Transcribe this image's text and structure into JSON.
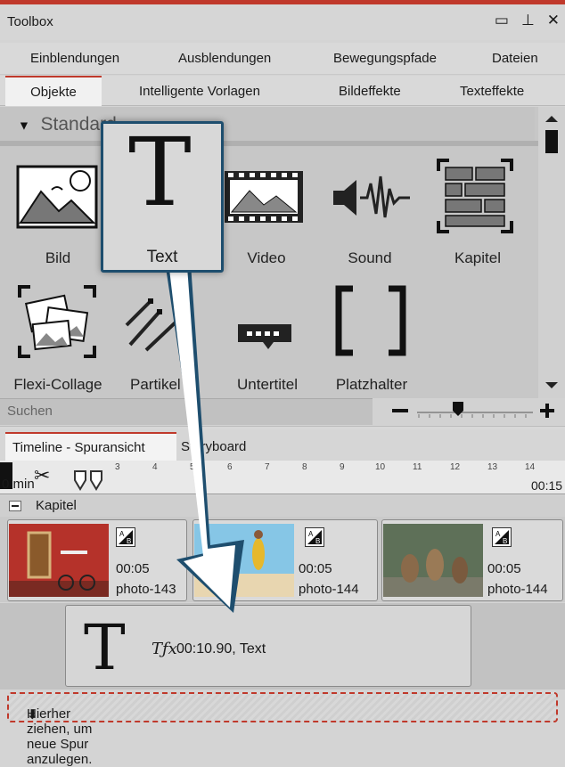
{
  "window": {
    "title": "Toolbox",
    "controls": [
      "minimize-icon",
      "pin-icon",
      "close-icon"
    ]
  },
  "tabs_row1": [
    "Einblendungen",
    "Ausblendungen",
    "Bewegungspfade",
    "Dateien"
  ],
  "tabs_row2": [
    "Objekte",
    "Intelligente Vorlagen",
    "Bildeffekte",
    "Texteffekte"
  ],
  "active_tab": "Objekte",
  "section": {
    "label": "Standard"
  },
  "objects": [
    {
      "label": "Bild",
      "icon": "image-icon"
    },
    {
      "label": "Text",
      "icon": "text-icon"
    },
    {
      "label": "Video",
      "icon": "film-icon"
    },
    {
      "label": "Sound",
      "icon": "sound-icon"
    },
    {
      "label": "Kapitel",
      "icon": "chapter-icon"
    },
    {
      "label": "Flexi-Collage",
      "icon": "collage-icon"
    },
    {
      "label": "Partikel",
      "icon": "particle-icon"
    },
    {
      "label": "Untertitel",
      "icon": "subtitle-icon"
    },
    {
      "label": "Platzhalter",
      "icon": "placeholder-icon"
    }
  ],
  "search": {
    "placeholder": "Suchen"
  },
  "drag_popup": {
    "label": "Text"
  },
  "timeline": {
    "tabs": [
      "Timeline - Spuransicht",
      "Storyboard"
    ],
    "ruler_start": "0 min",
    "ruler_ticks": [
      "3",
      "4",
      "5",
      "6",
      "7",
      "8",
      "9",
      "10",
      "11",
      "12",
      "13",
      "14"
    ],
    "ruler_end": "00:15",
    "chapter_label": "Kapitel",
    "clips": [
      {
        "duration": "00:05",
        "name": "photo-143"
      },
      {
        "duration": "00:05",
        "name": "photo-144"
      },
      {
        "duration": "00:05",
        "name": "photo-144"
      }
    ],
    "text_clip": {
      "info": "00:10.90, Text"
    },
    "drop_hint": "Hierher ziehen, um neue Spur anzulegen."
  },
  "colors": {
    "accent": "#c0392b",
    "popup_border": "#1e4e6e"
  }
}
